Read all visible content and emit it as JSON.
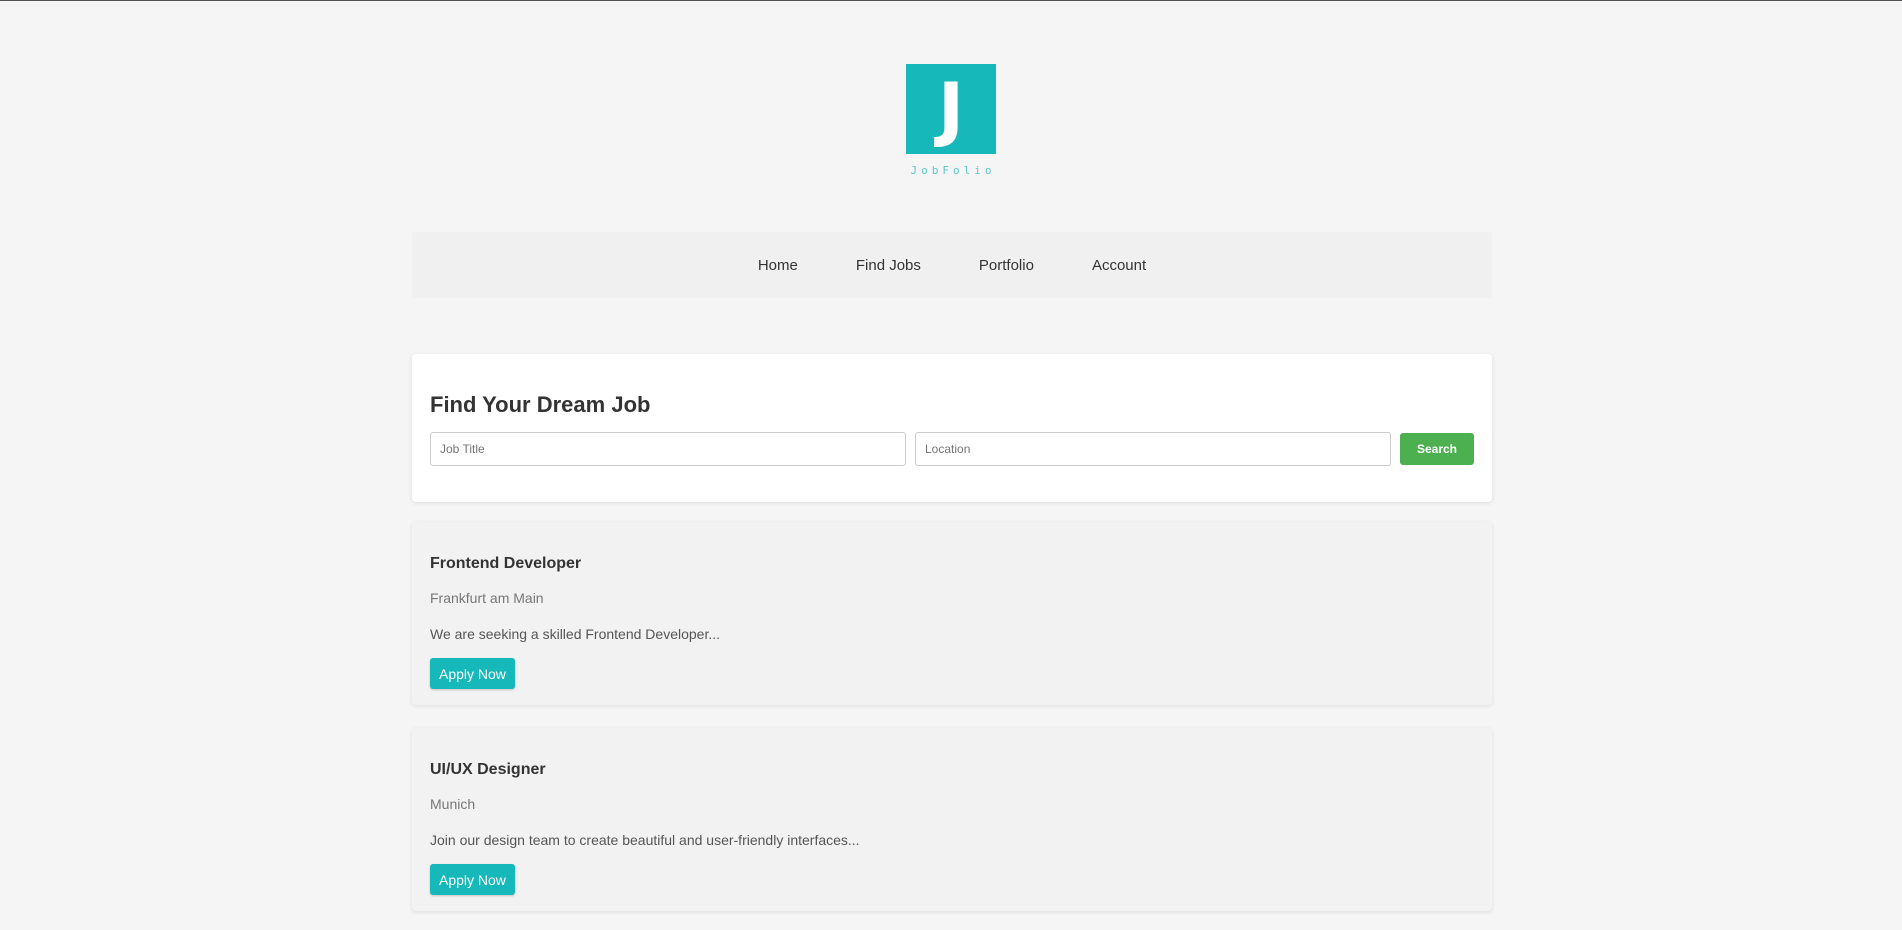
{
  "brand": {
    "logo_letter": "J",
    "name": "JobFolio",
    "color": "#17b8b9"
  },
  "nav": {
    "items": [
      {
        "label": "Home"
      },
      {
        "label": "Find Jobs"
      },
      {
        "label": "Portfolio"
      },
      {
        "label": "Account"
      }
    ]
  },
  "search": {
    "title": "Find Your Dream Job",
    "job_title_placeholder": "Job Title",
    "location_placeholder": "Location",
    "button_label": "Search",
    "button_color": "#4caf50"
  },
  "jobs": [
    {
      "title": "Frontend Developer",
      "location": "Frankfurt am Main",
      "description": "We are seeking a skilled Frontend Developer...",
      "apply_label": "Apply Now"
    },
    {
      "title": "UI/UX Designer",
      "location": "Munich",
      "description": "Join our design team to create beautiful and user-friendly interfaces...",
      "apply_label": "Apply Now"
    }
  ]
}
